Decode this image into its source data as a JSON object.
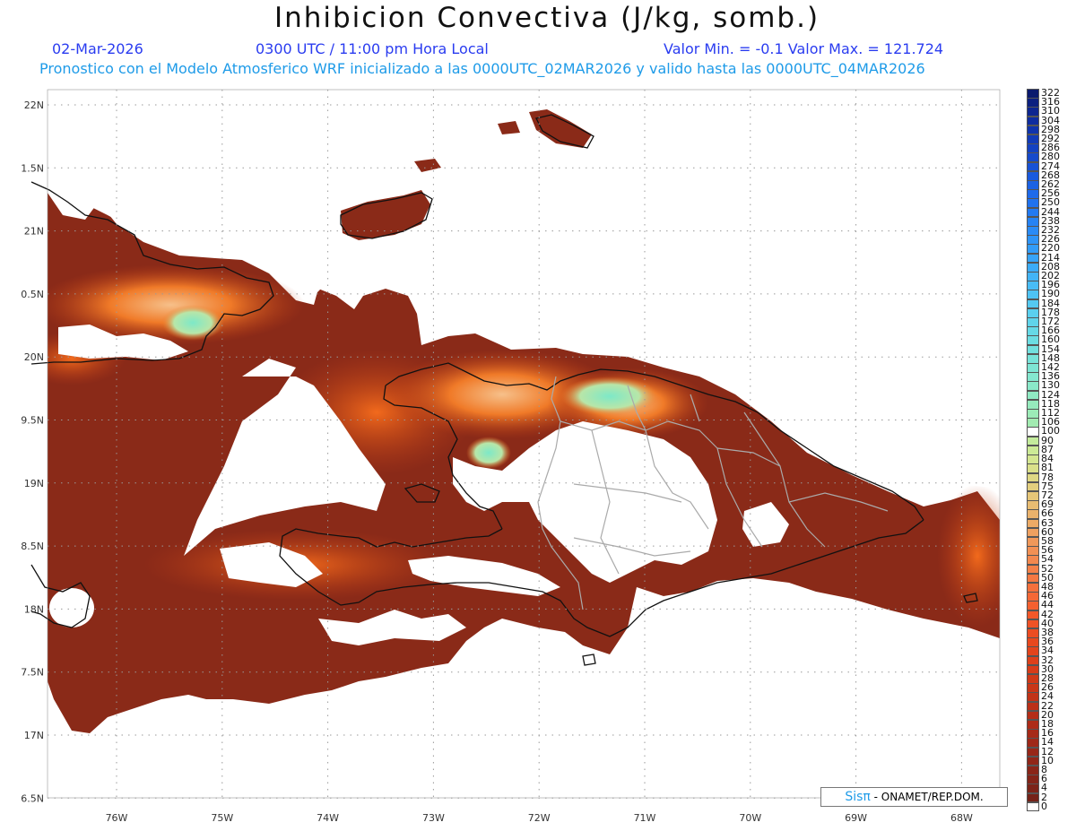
{
  "header": {
    "title": "Inhibicion Convectiva (J/kg, somb.)",
    "date": "02-Mar-2026",
    "time": "0300 UTC / 11:00 pm Hora Local",
    "range": "Valor Min. = -0.1  Valor Max. = 121.724",
    "forecast": "Pronostico con el Modelo Atmosferico WRF inicializado a las 0000UTC_02MAR2026 y valido hasta las  0000UTC_04MAR2026"
  },
  "map": {
    "lat_labels": [
      "22N",
      "1.5N",
      "21N",
      "0.5N",
      "20N",
      "9.5N",
      "19N",
      "8.5N",
      "18N",
      "7.5N",
      "17N",
      "6.5N"
    ],
    "lon_labels": [
      "76W",
      "75W",
      "74W",
      "73W",
      "72W",
      "71W",
      "70W",
      "69W",
      "68W"
    ],
    "colors": {
      "field_dark": "#8a2a18",
      "field_mid": "#b83a14",
      "field_bright": "#f06418",
      "field_light": "#f5b27a",
      "low_cin": "#7de8c8",
      "land": "#ffffff",
      "coast": "#111111",
      "border": "#aaaaaa"
    }
  },
  "colorbar": {
    "labels": [
      "322",
      "316",
      "310",
      "304",
      "298",
      "292",
      "286",
      "280",
      "274",
      "268",
      "262",
      "256",
      "250",
      "244",
      "238",
      "232",
      "226",
      "220",
      "214",
      "208",
      "202",
      "196",
      "190",
      "184",
      "178",
      "172",
      "166",
      "160",
      "154",
      "148",
      "142",
      "136",
      "130",
      "124",
      "118",
      "112",
      "106",
      "100",
      "90",
      "87",
      "84",
      "81",
      "78",
      "75",
      "72",
      "69",
      "66",
      "63",
      "60",
      "58",
      "56",
      "54",
      "52",
      "50",
      "48",
      "46",
      "44",
      "42",
      "40",
      "38",
      "36",
      "34",
      "32",
      "30",
      "28",
      "26",
      "24",
      "22",
      "20",
      "18",
      "16",
      "14",
      "12",
      "10",
      "8",
      "6",
      "4",
      "2",
      "0"
    ],
    "colors": [
      "#0a1a6e",
      "#0c2080",
      "#0e2690",
      "#0f2da0",
      "#1034ad",
      "#123bb8",
      "#1442c2",
      "#164acc",
      "#1852d6",
      "#1a5ade",
      "#1c62e4",
      "#1e6aea",
      "#2072ee",
      "#237af2",
      "#2683f4",
      "#2a8bf6",
      "#2e94f7",
      "#329cf8",
      "#37a4f8",
      "#3cacf8",
      "#42b4f7",
      "#48bcf6",
      "#4ec3f4",
      "#54c9f1",
      "#5acfee",
      "#60d4ea",
      "#66d9e6",
      "#6cdde2",
      "#72e0de",
      "#78e3d9",
      "#7ee5d4",
      "#84e7cf",
      "#8ae8c9",
      "#90e9c3",
      "#96eabd",
      "#9cebb7",
      "#a2ebb1",
      "#ffffff",
      "#c4ec9c",
      "#ccea96",
      "#d4e690",
      "#dae08a",
      "#dfd884",
      "#e3cf7e",
      "#e6c678",
      "#e8bc72",
      "#eab26c",
      "#ecaa66",
      "#eea060",
      "#f0985a",
      "#f29054",
      "#f3884e",
      "#f48048",
      "#f47842",
      "#f5703c",
      "#f56836",
      "#f46030",
      "#f2582a",
      "#ef5226",
      "#ec4c22",
      "#e8481e",
      "#e3441c",
      "#dd401a",
      "#d73c19",
      "#d03918",
      "#c93618",
      "#c23318",
      "#bb3018",
      "#b42e18",
      "#ad2c18",
      "#a62a18",
      "#9f2818",
      "#982718",
      "#912618",
      "#8a2518",
      "#832418",
      "#7c2318",
      "#752218",
      "#ffffff"
    ]
  },
  "credit": {
    "logo": "Sisπ",
    "text": "- ONAMET/REP.DOM."
  }
}
